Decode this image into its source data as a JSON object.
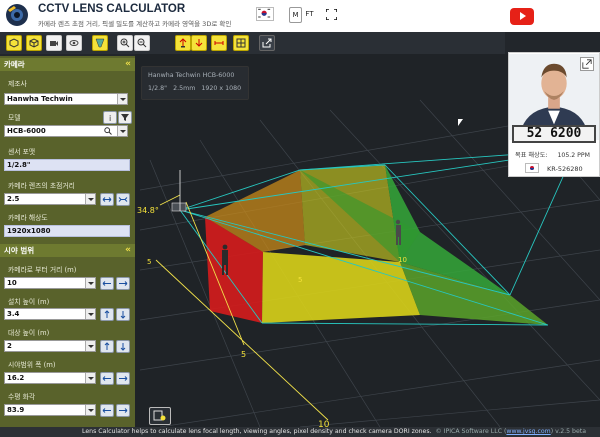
{
  "header": {
    "title": "CCTV LENS CALCULATOR",
    "subtitle": "카메라 렌즈 초점 거리, 픽셀 밀도를 계산하고 카메라 영역을 3D로 확인",
    "unit_m": "M",
    "unit_ft": "FT"
  },
  "camera_section": {
    "title": "카메라",
    "manufacturer_label": "제조사",
    "manufacturer_value": "Hanwha Techwin",
    "model_label": "모델",
    "model_value": "HCB-6000",
    "sensor_label": "센서 포맷",
    "sensor_value": "1/2.8\"",
    "lens_label": "카메라 렌즈의 초점거리",
    "lens_value": "2.5",
    "resolution_label": "카메라 해상도",
    "resolution_value": "1920x1080"
  },
  "fov_section": {
    "title": "시야 범위",
    "distance_label": "카메라로 부터 거리 (m)",
    "distance_value": "10",
    "install_height_label": "설치 높이 (m)",
    "install_height_value": "3.4",
    "target_height_label": "대상 높이 (m)",
    "target_height_value": "2",
    "fov_width_label": "시야범위 폭 (m)",
    "fov_width_value": "16.2",
    "hfov_label": "수평 화각",
    "hfov_value": "83.9"
  },
  "info_overlay": {
    "model": "Hanwha Techwin HCB-6000",
    "sensor": "1/2.8\"",
    "focal": "2.5mm",
    "resolution": "1920 x 1080"
  },
  "preview": {
    "plate_text": "52 6200",
    "ppm_label": "목표 해상도:",
    "ppm_value": "105.2 PPM",
    "plate_id": "KR-526280"
  },
  "scene": {
    "angle_label": "34.8°",
    "tick_5": "5",
    "tick_10": "10"
  },
  "footer": {
    "text": "Lens Calculator helps to calculate lens focal length, viewing angles, pixel density and check camera DORI zones.",
    "copyright": "© IPICA Software LLC (",
    "link": "www.jvsg.com",
    "version": ") v.2.5 beta"
  },
  "colors": {
    "panel": "#59622b",
    "section": "#6e7a30",
    "accent_yellow": "#f4e23a",
    "zone_green": "#2ea02e",
    "zone_yellow": "#d7cc18",
    "zone_red": "#d61f1f",
    "fov_line": "#27c7c0"
  },
  "icons": [
    "camera-3d-icon",
    "box-icon",
    "video-icon",
    "rotate-view-icon",
    "projection-icon",
    "zoom-in-icon",
    "zoom-out-icon",
    "camera-up-icon",
    "camera-down-icon",
    "ruler-icon",
    "grid-icon",
    "share-icon",
    "search-icon",
    "filter-icon",
    "info-icon",
    "arrows-icon",
    "expand-icon",
    "youtube-icon"
  ]
}
